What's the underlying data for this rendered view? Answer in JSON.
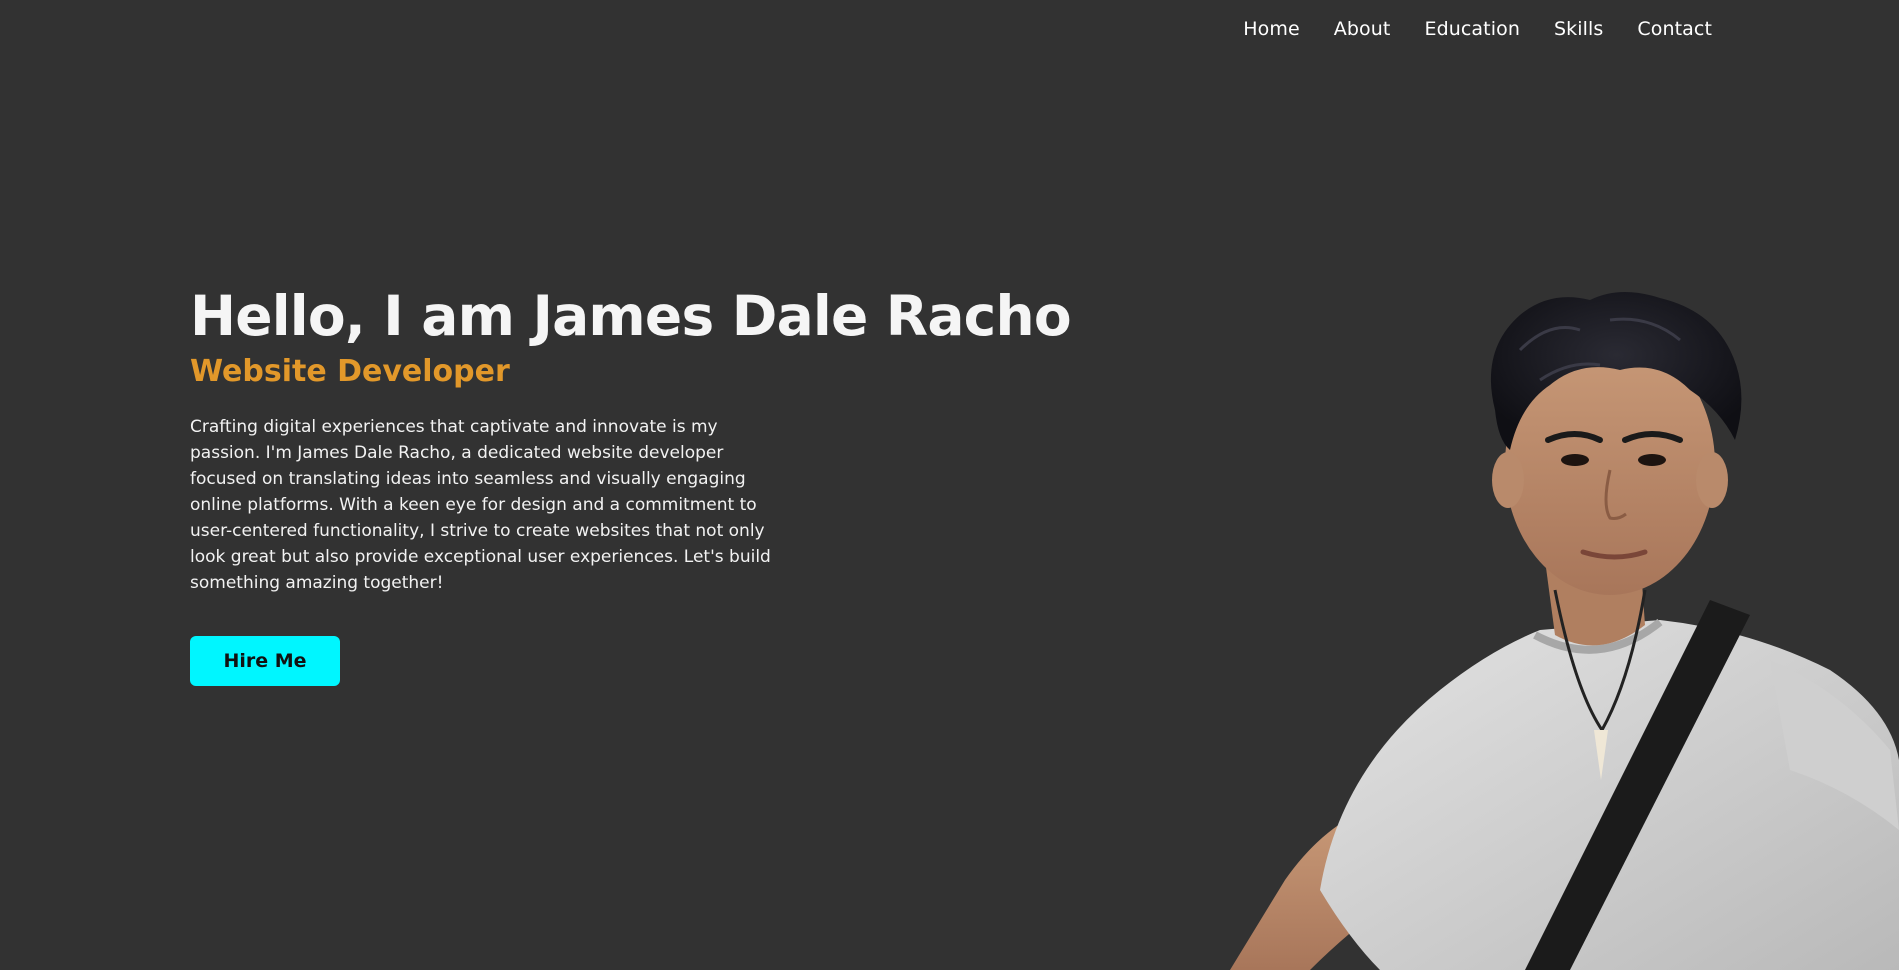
{
  "nav": {
    "items": [
      {
        "label": "Home"
      },
      {
        "label": "About"
      },
      {
        "label": "Education"
      },
      {
        "label": "Skills"
      },
      {
        "label": "Contact"
      }
    ]
  },
  "hero": {
    "title": "Hello, I am James Dale Racho",
    "role": "Website Developer",
    "description": "Crafting digital experiences that captivate and innovate is my passion. I'm James Dale Racho, a dedicated website developer focused on translating ideas into seamless and visually engaging online platforms. With a keen eye for design and a commitment to user-centered functionality, I strive to create websites that not only look great but also provide exceptional user experiences. Let's build something amazing together!",
    "cta_label": "Hire Me"
  },
  "colors": {
    "background": "#323232",
    "accent": "#e2982a",
    "button": "#00f6ff"
  }
}
